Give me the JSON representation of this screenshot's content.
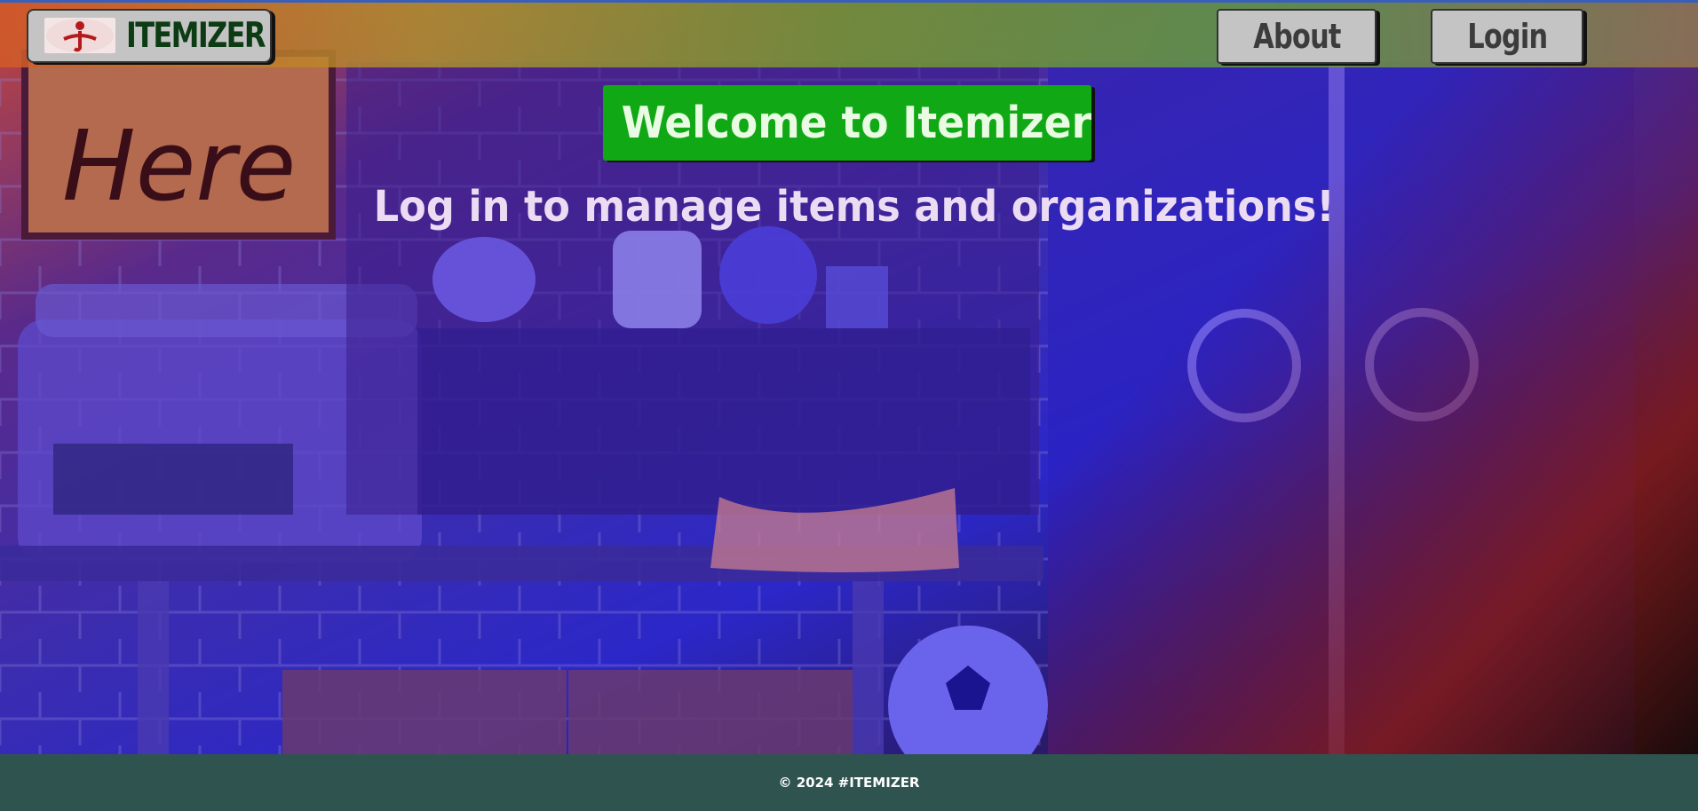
{
  "header": {
    "logo_text": "ITEMIZER",
    "about_label": "About",
    "login_label": "Login"
  },
  "hero": {
    "welcome_text": "Welcome to Itemizer!",
    "tagline": "Log in to manage items and organizations!"
  },
  "background": {
    "sign_text": "Stuff Here"
  },
  "footer": {
    "copyright": "© 2024 #ITEMIZER"
  },
  "colors": {
    "welcome_bg": "#10a915",
    "footer_bg": "#2f5450",
    "nav_button_bg": "#c4c4c4",
    "logo_text": "#0c3b14"
  }
}
